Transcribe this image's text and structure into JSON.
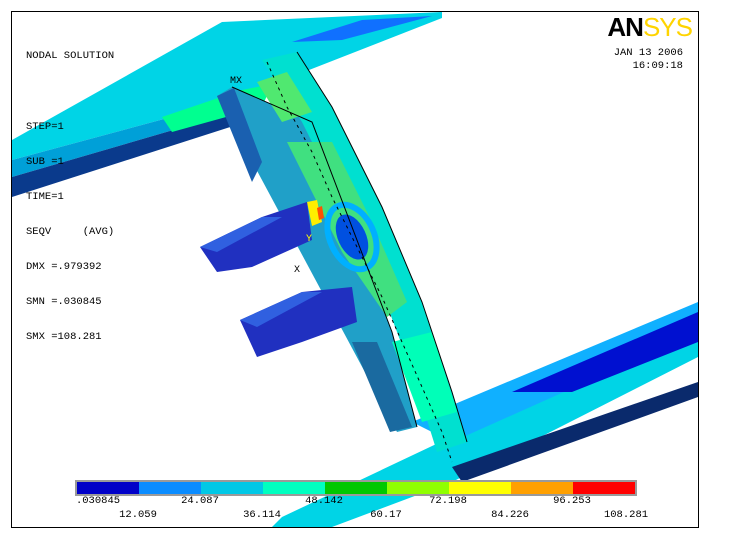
{
  "header": {
    "title": "NODAL SOLUTION",
    "step": "STEP=1",
    "sub": "SUB =1",
    "time": "TIME=1",
    "result": "SEQV     (AVG)",
    "dmx": "DMX =.979392",
    "smn": "SMN =.030845",
    "smx": "SMX =108.281"
  },
  "brand": {
    "an": "AN",
    "sys": "SYS"
  },
  "datestamp": {
    "date": "JAN 13 2006",
    "time": "16:09:18"
  },
  "markers": {
    "mx": "MX",
    "y_axis": "Y",
    "x_axis": "X"
  },
  "legend": {
    "colors": [
      "#0000c8",
      "#0a8cff",
      "#00c8e6",
      "#00ffc0",
      "#00c800",
      "#90ff00",
      "#ffff00",
      "#ffa000",
      "#ff0000"
    ],
    "upper_labels": [
      ".030845",
      "24.087",
      "48.142",
      "72.198",
      "96.253"
    ],
    "lower_labels": [
      "12.059",
      "36.114",
      "60.17",
      "84.226",
      "108.281"
    ]
  }
}
